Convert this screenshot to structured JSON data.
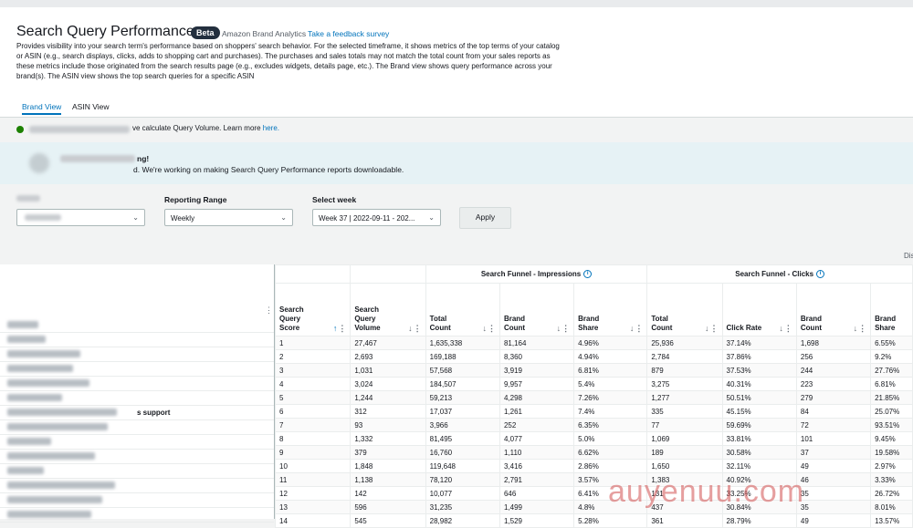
{
  "header": {
    "title": "Search Query Performance",
    "beta_badge": "Beta",
    "subtitle": "Amazon Brand Analytics",
    "feedback_link": "Take a feedback survey",
    "description": "Provides visibility into your search term's performance based on shoppers' search behavior. For the selected timeframe, it shows metrics of the top terms of your catalog or ASIN (e.g., search displays, clicks, adds to shopping cart and purchases). The purchases and sales totals may not match the total count from your sales reports as these metrics include those originated from the search results page (e.g., excludes widgets, details page, etc.). The Brand view shows query performance across your brand(s). The ASIN view shows the top search queries for a specific ASIN"
  },
  "tabs": [
    {
      "label": "Brand View",
      "active": true
    },
    {
      "label": "ASIN View",
      "active": false
    }
  ],
  "info_line": {
    "text": "ve calculate Query Volume. Learn more ",
    "link": "here."
  },
  "banner": {
    "line1": "ng!",
    "line2": "d. We're working on making Search Query Performance reports downloadable."
  },
  "filters": {
    "reporting_range_label": "Reporting Range",
    "reporting_range_value": "Weekly",
    "select_week_label": "Select week",
    "select_week_value": "Week 37 | 2022-09-11 - 202...",
    "apply_label": "Apply"
  },
  "display_text": "Dis",
  "support_text": "s support",
  "table": {
    "groups": {
      "impressions": "Search Funnel - Impressions",
      "clicks": "Search Funnel - Clicks"
    },
    "columns": {
      "score": "Search Query Score",
      "volume": "Search Query Volume",
      "imp_total": "Total Count",
      "imp_brand_count": "Brand Count",
      "imp_brand_share": "Brand Share",
      "clk_total": "Total Count",
      "click_rate": "Click Rate",
      "clk_brand_count": "Brand Count",
      "clk_brand_share": "Brand Share"
    },
    "rows": [
      [
        "1",
        "27,467",
        "1,635,338",
        "81,164",
        "4.96%",
        "25,936",
        "37.14%",
        "1,698",
        "6.55%"
      ],
      [
        "2",
        "2,693",
        "169,188",
        "8,360",
        "4.94%",
        "2,784",
        "37.86%",
        "256",
        "9.2%"
      ],
      [
        "3",
        "1,031",
        "57,568",
        "3,919",
        "6.81%",
        "879",
        "37.53%",
        "244",
        "27.76%"
      ],
      [
        "4",
        "3,024",
        "184,507",
        "9,957",
        "5.4%",
        "3,275",
        "40.31%",
        "223",
        "6.81%"
      ],
      [
        "5",
        "1,244",
        "59,213",
        "4,298",
        "7.26%",
        "1,277",
        "50.51%",
        "279",
        "21.85%"
      ],
      [
        "6",
        "312",
        "17,037",
        "1,261",
        "7.4%",
        "335",
        "45.15%",
        "84",
        "25.07%"
      ],
      [
        "7",
        "93",
        "3,966",
        "252",
        "6.35%",
        "77",
        "59.69%",
        "72",
        "93.51%"
      ],
      [
        "8",
        "1,332",
        "81,495",
        "4,077",
        "5.0%",
        "1,069",
        "33.81%",
        "101",
        "9.45%"
      ],
      [
        "9",
        "379",
        "16,760",
        "1,110",
        "6.62%",
        "189",
        "30.58%",
        "37",
        "19.58%"
      ],
      [
        "10",
        "1,848",
        "119,648",
        "3,416",
        "2.86%",
        "1,650",
        "32.11%",
        "49",
        "2.97%"
      ],
      [
        "11",
        "1,138",
        "78,120",
        "2,791",
        "3.57%",
        "1,383",
        "40.92%",
        "46",
        "3.33%"
      ],
      [
        "12",
        "142",
        "10,077",
        "646",
        "6.41%",
        "131",
        "33.25%",
        "35",
        "26.72%"
      ],
      [
        "13",
        "596",
        "31,235",
        "1,499",
        "4.8%",
        "437",
        "30.84%",
        "35",
        "8.01%"
      ],
      [
        "14",
        "545",
        "28,982",
        "1,529",
        "5.28%",
        "361",
        "28.79%",
        "49",
        "13.57%"
      ]
    ]
  },
  "watermark": "auyenuu.com"
}
